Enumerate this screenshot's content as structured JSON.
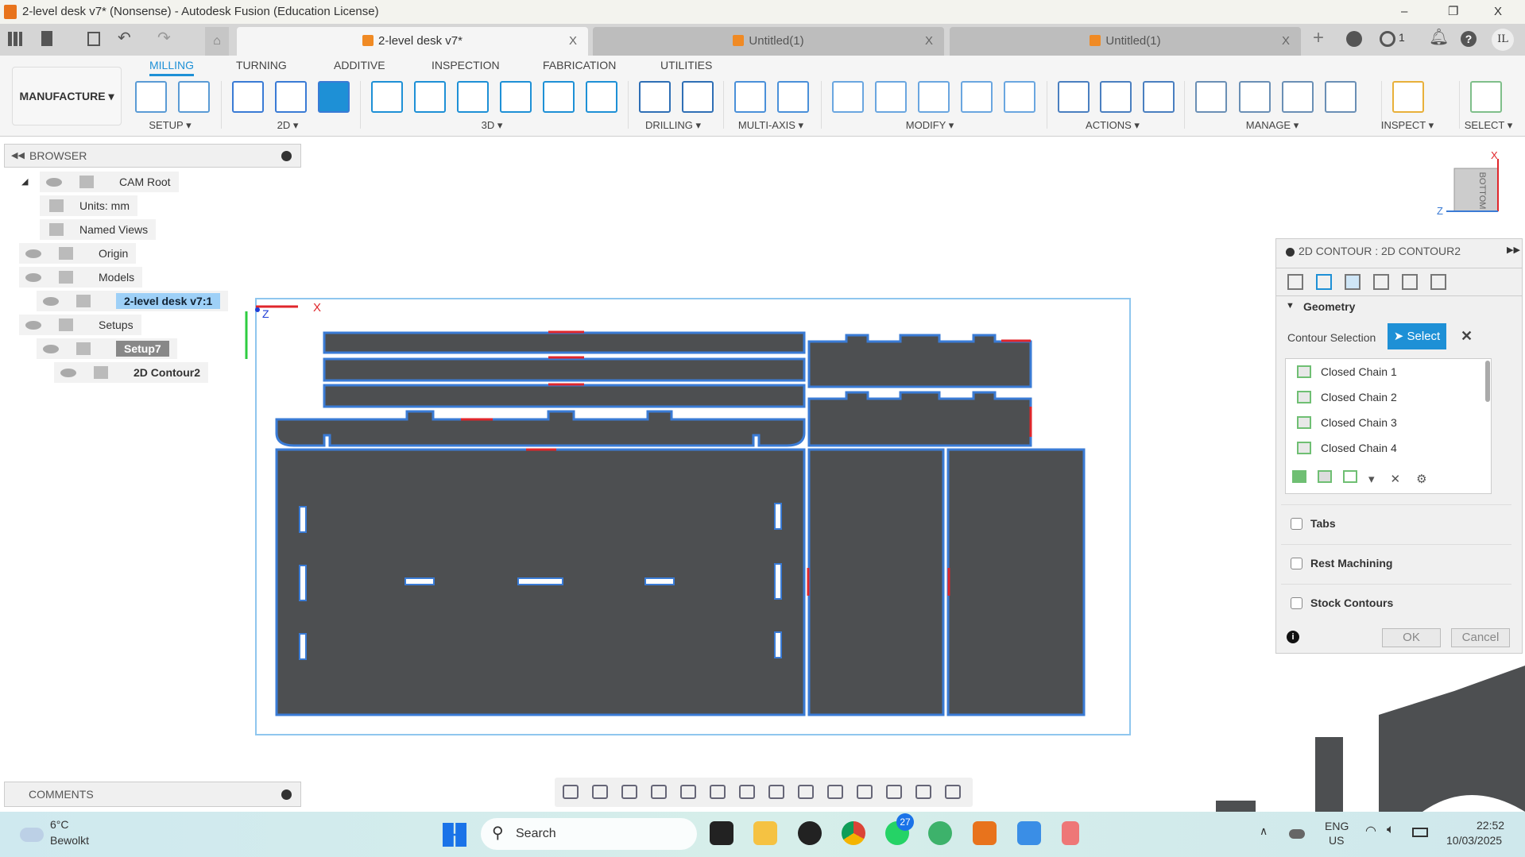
{
  "window": {
    "title": "2-level desk v7* (Nonsense) - Autodesk Fusion (Education License)",
    "minimize": "–",
    "restore": "❐",
    "close": "X"
  },
  "doc_tabs": [
    {
      "label": "2-level desk v7*",
      "active": true
    },
    {
      "label": "Untitled(1)",
      "active": false
    },
    {
      "label": "Untitled(1)",
      "active": false
    }
  ],
  "tabbar_right": {
    "notifications_count": "1",
    "user_initials": "IL"
  },
  "workspace": "MANUFACTURE",
  "ribbon_tabs": [
    "MILLING",
    "TURNING",
    "ADDITIVE",
    "INSPECTION",
    "FABRICATION",
    "UTILITIES"
  ],
  "ribbon_groups": [
    {
      "label": "SETUP",
      "icons": [
        "new-setup-icon",
        "nc-program-icon"
      ]
    },
    {
      "label": "2D",
      "icons": [
        "2d-adaptive-icon",
        "2d-pocket-icon",
        "2d-contour-icon"
      ]
    },
    {
      "label": "3D",
      "icons": [
        "3d-adaptive-icon",
        "3d-pocket-icon",
        "steep-shallow-icon",
        "flow-icon",
        "scallop-icon",
        "ramp-icon"
      ]
    },
    {
      "label": "DRILLING",
      "icons": [
        "drill-icon",
        "hole-recognition-icon"
      ]
    },
    {
      "label": "MULTI-AXIS",
      "icons": [
        "swarf-icon",
        "multi-axis-contour-icon"
      ]
    },
    {
      "label": "MODIFY",
      "icons": [
        "trim-icon",
        "delete-toolpath-icon",
        "edit-toolpath-icon",
        "move-tool-icon",
        "transform-icon"
      ]
    },
    {
      "label": "ACTIONS",
      "icons": [
        "simulate-icon",
        "post-process-icon",
        "setup-sheet-icon"
      ]
    },
    {
      "label": "MANAGE",
      "icons": [
        "tool-library-icon",
        "machine-library-icon",
        "post-library-icon",
        "template-library-icon"
      ]
    },
    {
      "label": "INSPECT",
      "icons": [
        "measure-icon"
      ]
    },
    {
      "label": "SELECT",
      "icons": [
        "select-icon"
      ]
    }
  ],
  "browser": {
    "title": "BROWSER",
    "items": [
      "CAM Root",
      "Units: mm",
      "Named Views",
      "Origin",
      "Models",
      "2-level desk v7:1",
      "Setups",
      "Setup7",
      "2D Contour2"
    ]
  },
  "comments": {
    "title": "COMMENTS"
  },
  "viewcube": {
    "face": "BOTTOM",
    "axis_x": "X",
    "axis_z": "Z"
  },
  "triad": {
    "x": "X",
    "z": "Z"
  },
  "panel": {
    "title": "2D CONTOUR : 2D CONTOUR2",
    "section": "Geometry",
    "contour_label": "Contour Selection",
    "select_button": "Select",
    "chains": [
      "Closed Chain 1",
      "Closed Chain 2",
      "Closed Chain 3",
      "Closed Chain 4"
    ],
    "options": [
      {
        "label": "Tabs",
        "checked": false
      },
      {
        "label": "Rest Machining",
        "checked": false
      },
      {
        "label": "Stock Contours",
        "checked": false
      }
    ],
    "ok": "OK",
    "cancel": "Cancel"
  },
  "taskbar": {
    "temp": "6°C",
    "weather": "Bewolkt",
    "search_placeholder": "Search",
    "whatsapp_badge": "27",
    "lang1": "ENG",
    "lang2": "US",
    "time": "22:52",
    "date": "10/03/2025"
  },
  "colors": {
    "accent": "#1e90d6",
    "part": "#4d4f51",
    "outline": "#3a7bd5",
    "arrow": "#e0262b"
  }
}
